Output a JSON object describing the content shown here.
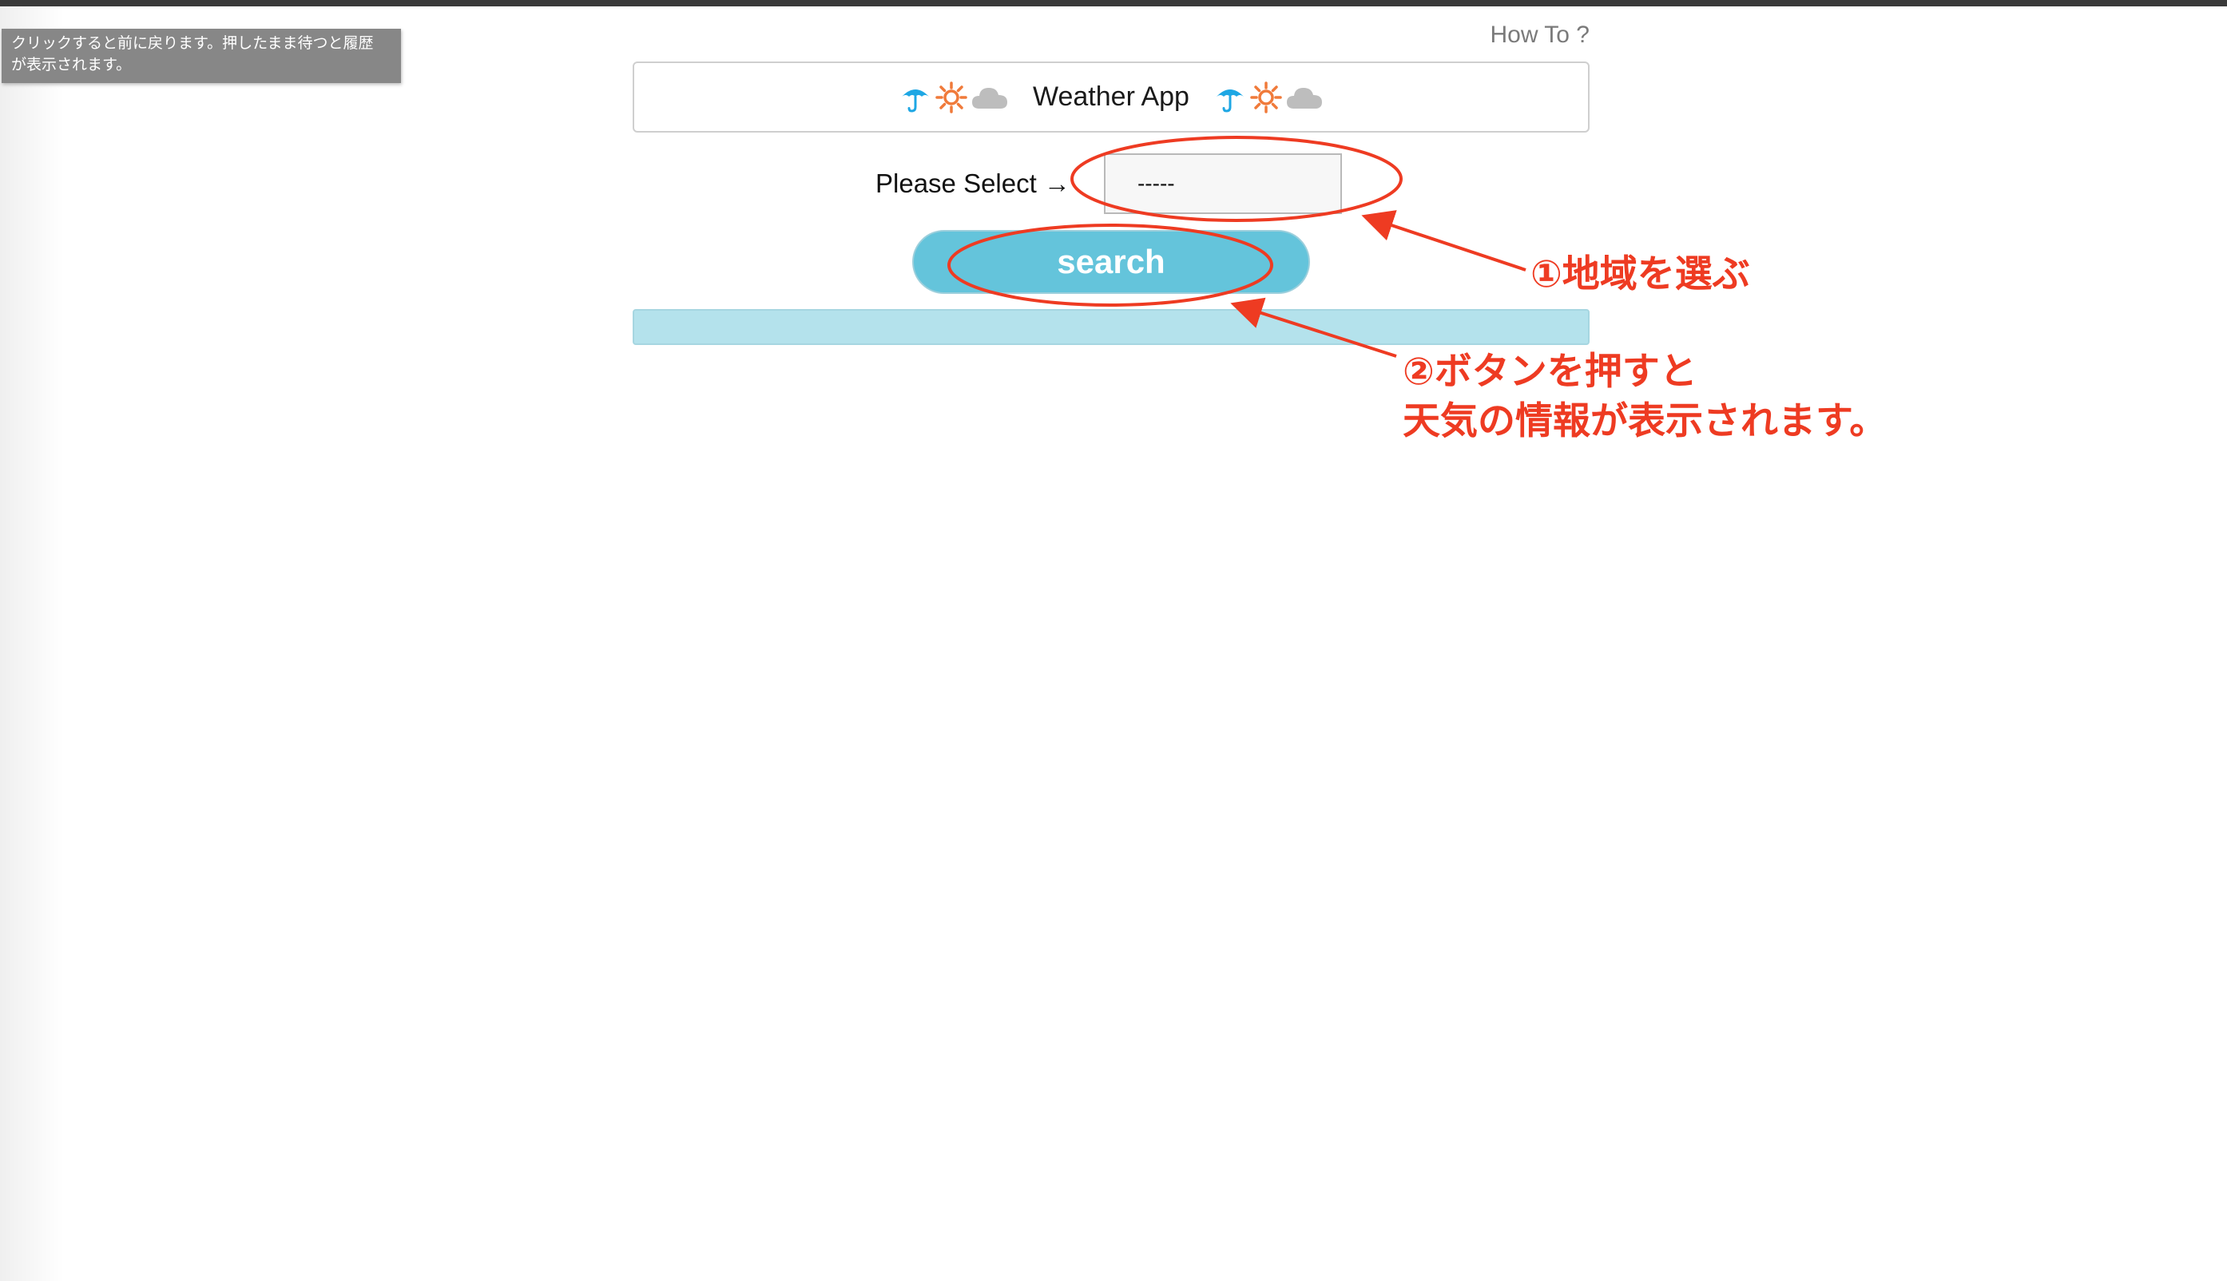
{
  "tooltip": {
    "line1": "クリックすると前に戻ります。押したまま待つと履歴",
    "line2": "が表示されます。"
  },
  "header": {
    "howto_label": "How To ?",
    "title": "Weather App",
    "icons": [
      "umbrella-icon",
      "sun-icon",
      "cloud-icon"
    ]
  },
  "form": {
    "select_label": "Please Select →",
    "select_value": "-----",
    "search_label": "search"
  },
  "annotations": {
    "step1": "①地域を選ぶ",
    "step2_line1": "②ボタンを押すと",
    "step2_line2": "天気の情報が表示されます。"
  },
  "colors": {
    "accent": "#64c4db",
    "annotation": "#ee3b22",
    "umbrella": "#1ea7e4",
    "sun": "#f07a3a",
    "cloud": "#bdbdbd"
  }
}
